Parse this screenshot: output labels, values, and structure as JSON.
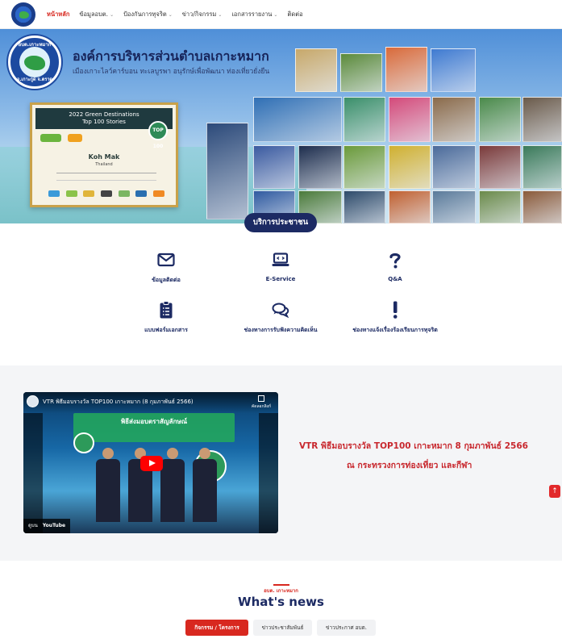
{
  "nav": {
    "items": [
      {
        "label": "หน้าหลัก",
        "active": true,
        "has_caret": false
      },
      {
        "label": "ข้อมูลอบต.",
        "active": false,
        "has_caret": true
      },
      {
        "label": "ป้องกันการทุจริต",
        "active": false,
        "has_caret": true
      },
      {
        "label": "ข่าว/กิจกรรม",
        "active": false,
        "has_caret": true
      },
      {
        "label": "เอกสารรายงาน",
        "active": false,
        "has_caret": true
      },
      {
        "label": "ติดต่อ",
        "active": false,
        "has_caret": false
      }
    ]
  },
  "hero": {
    "seal_top": "อบต.เกาะหมาก",
    "seal_bottom": "อ.เกาะกูด จ.ตราด",
    "title": "องค์การบริหารส่วนตำบลเกาะหมาก",
    "subtitle": "เมืองเกาะไลว์คาร์บอน ทะเลบูรพา อนุรักษ์เพื่อพัฒนา ท่องเที่ยวยั่งยืน",
    "certificate": {
      "heading_line1": "2022 Green Destinations",
      "heading_line2": "Top 100 Stories",
      "badge": "TOP 100",
      "name": "Koh Mak",
      "country": "Thailand"
    },
    "badge_label": "บริการประชาชน"
  },
  "services": [
    {
      "label": "ข้อมูลติดต่อ",
      "icon": "envelope-icon"
    },
    {
      "label": "E-Service",
      "icon": "laptop-icon"
    },
    {
      "label": "Q&A",
      "icon": "question-icon"
    },
    {
      "label": "แบบฟอร์มเอกสาร",
      "icon": "clipboard-icon"
    },
    {
      "label": "ช่องทางการรับฟังความคิดเห็น",
      "icon": "comments-icon"
    },
    {
      "label": "ช่องทางแจ้งเรื่องร้องเรียนการทุจริต",
      "icon": "exclamation-icon"
    }
  ],
  "video": {
    "title": "VTR พิธีมอบรางวัล TOP100 เกาะหมาก (8 กุมภาพันธ์ 2566)",
    "copy_link": "คัดลอกลิงก์",
    "banner": "พิธีส่งมอบตราสัญลักษณ์",
    "watch_on": "ดูบน",
    "youtube": "YouTube"
  },
  "vtr_caption": {
    "line1": "VTR พิธีมอบรางวัล TOP100 เกาะหมาก 8 กุมภาพันธ์ 2566",
    "line2": "ณ กระทรวงการท่องเที่ยว และกีฬา"
  },
  "news": {
    "kicker": "อบต. เกาะหมาก",
    "title": "What's news",
    "tabs": [
      {
        "label": "กิจกรรม / โครงการ",
        "active": true
      },
      {
        "label": "ข่าวประชาสัมพันธ์",
        "active": false
      },
      {
        "label": "ข่าวประกาศ อบต.",
        "active": false
      }
    ]
  },
  "colors": {
    "accent_red": "#d8281f",
    "navy": "#1c2a63"
  }
}
